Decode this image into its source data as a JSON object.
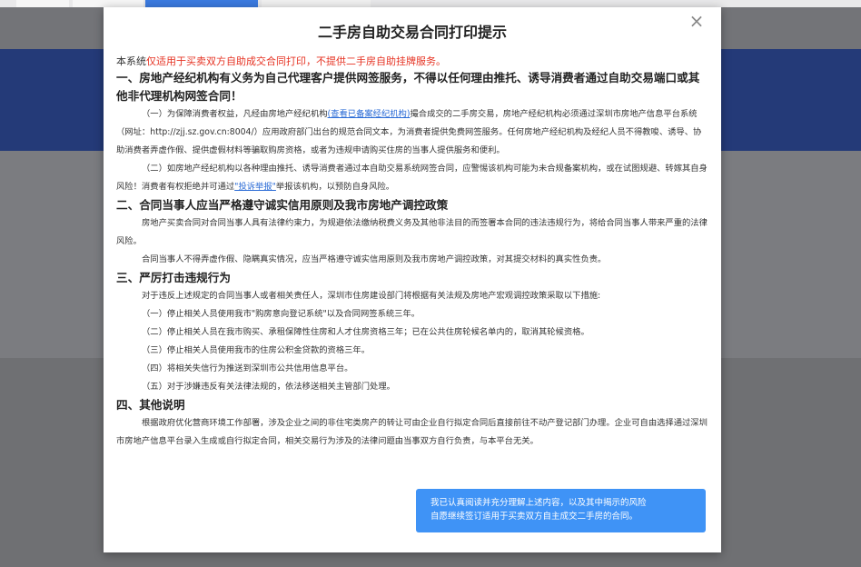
{
  "modal": {
    "title": "二手房自助交易合同打印提示",
    "close_symbol": "×",
    "intro_prefix": "本系统",
    "intro_highlight": "仅适用于买卖双方自助成交合同打印，不提供二手房自助挂牌服务。",
    "section1_heading": "一、房地产经纪机构有义务为自己代理客户提供网签服务，不得以任何理由推托、诱导消费者通过自助交易端口或其他非代理机构网签合同！",
    "s1p1_a": "（一）为保障消费者权益，凡经由房地产经纪机构",
    "s1p1_link": "(查看已备案经纪机构)",
    "s1p1_b": "撮合成交的二手房交易，房地产经纪机构必须通过深圳市房地产信息平台系统（网址：http://zjj.sz.gov.cn:8004/）应用政府部门出台的规范合同文本，为消费者提供免费网签服务。任何房地产经纪机构及经纪人员不得教唆、诱导、协助消费者弄虚作假、提供虚假材料等骗取购房资格，或者为违规申请购买住房的当事人提供服务和便利。",
    "s1p2_a": "（二）如房地产经纪机构以各种理由推托、诱导消费者通过本自助交易系统网签合同，应警惕该机构可能为未合规备案机构，或在试图规避、转嫁其自身风险！消费者有权拒绝并可通过",
    "s1p2_link": "\"投诉举报\"",
    "s1p2_b": "举报该机构，以预防自身风险。",
    "section2_heading": "二、合同当事人应当严格遵守诚实信用原则及我市房地产调控政策",
    "s2p1": "房地产买卖合同对合同当事人具有法律约束力，为规避依法缴纳税费义务及其他非法目的而签署本合同的违法违规行为，将给合同当事人带来严重的法律风险。",
    "s2p2": "合同当事人不得弄虚作假、隐瞒真实情况，应当严格遵守诚实信用原则及我市房地产调控政策，对其提交材料的真实性负责。",
    "section3_heading": "三、严厉打击违规行为",
    "s3p1": "对于违反上述规定的合同当事人或者相关责任人，深圳市住房建设部门将根据有关法规及房地产宏观调控政策采取以下措施:",
    "s3_items": [
      "（一）停止相关人员使用我市\"购房意向登记系统\"以及合同网签系统三年。",
      "（二）停止相关人员在我市购买、承租保障性住房和人才住房资格三年；已在公共住房轮候名单内的，取消其轮候资格。",
      "（三）停止相关人员使用我市的住房公积金贷款的资格三年。",
      "（四）将相关失信行为推送到深圳市公共信用信息平台。",
      "（五）对于涉嫌违反有关法律法规的，依法移送相关主管部门处理。"
    ],
    "section4_heading": "四、其他说明",
    "s4p1": "根据政府优化营商环境工作部署，涉及企业之间的非住宅类房产的转让可由企业自行拟定合同后直接前往不动产登记部门办理。企业可自由选择通过深圳市房地产信息平台录入生成或自行拟定合同，相关交易行为涉及的法律问题由当事双方自行负责，与本平台无关。",
    "agree_line1": "我已认真阅读并充分理解上述内容，以及其中揭示的风险",
    "agree_line2": "自愿继续签订适用于买卖双方自主成交二手房的合同。"
  },
  "colors": {
    "highlight_red": "#e63323",
    "link_blue": "#2a6bd6",
    "button_blue": "#3f93f6",
    "header_blue": "#243a78"
  }
}
